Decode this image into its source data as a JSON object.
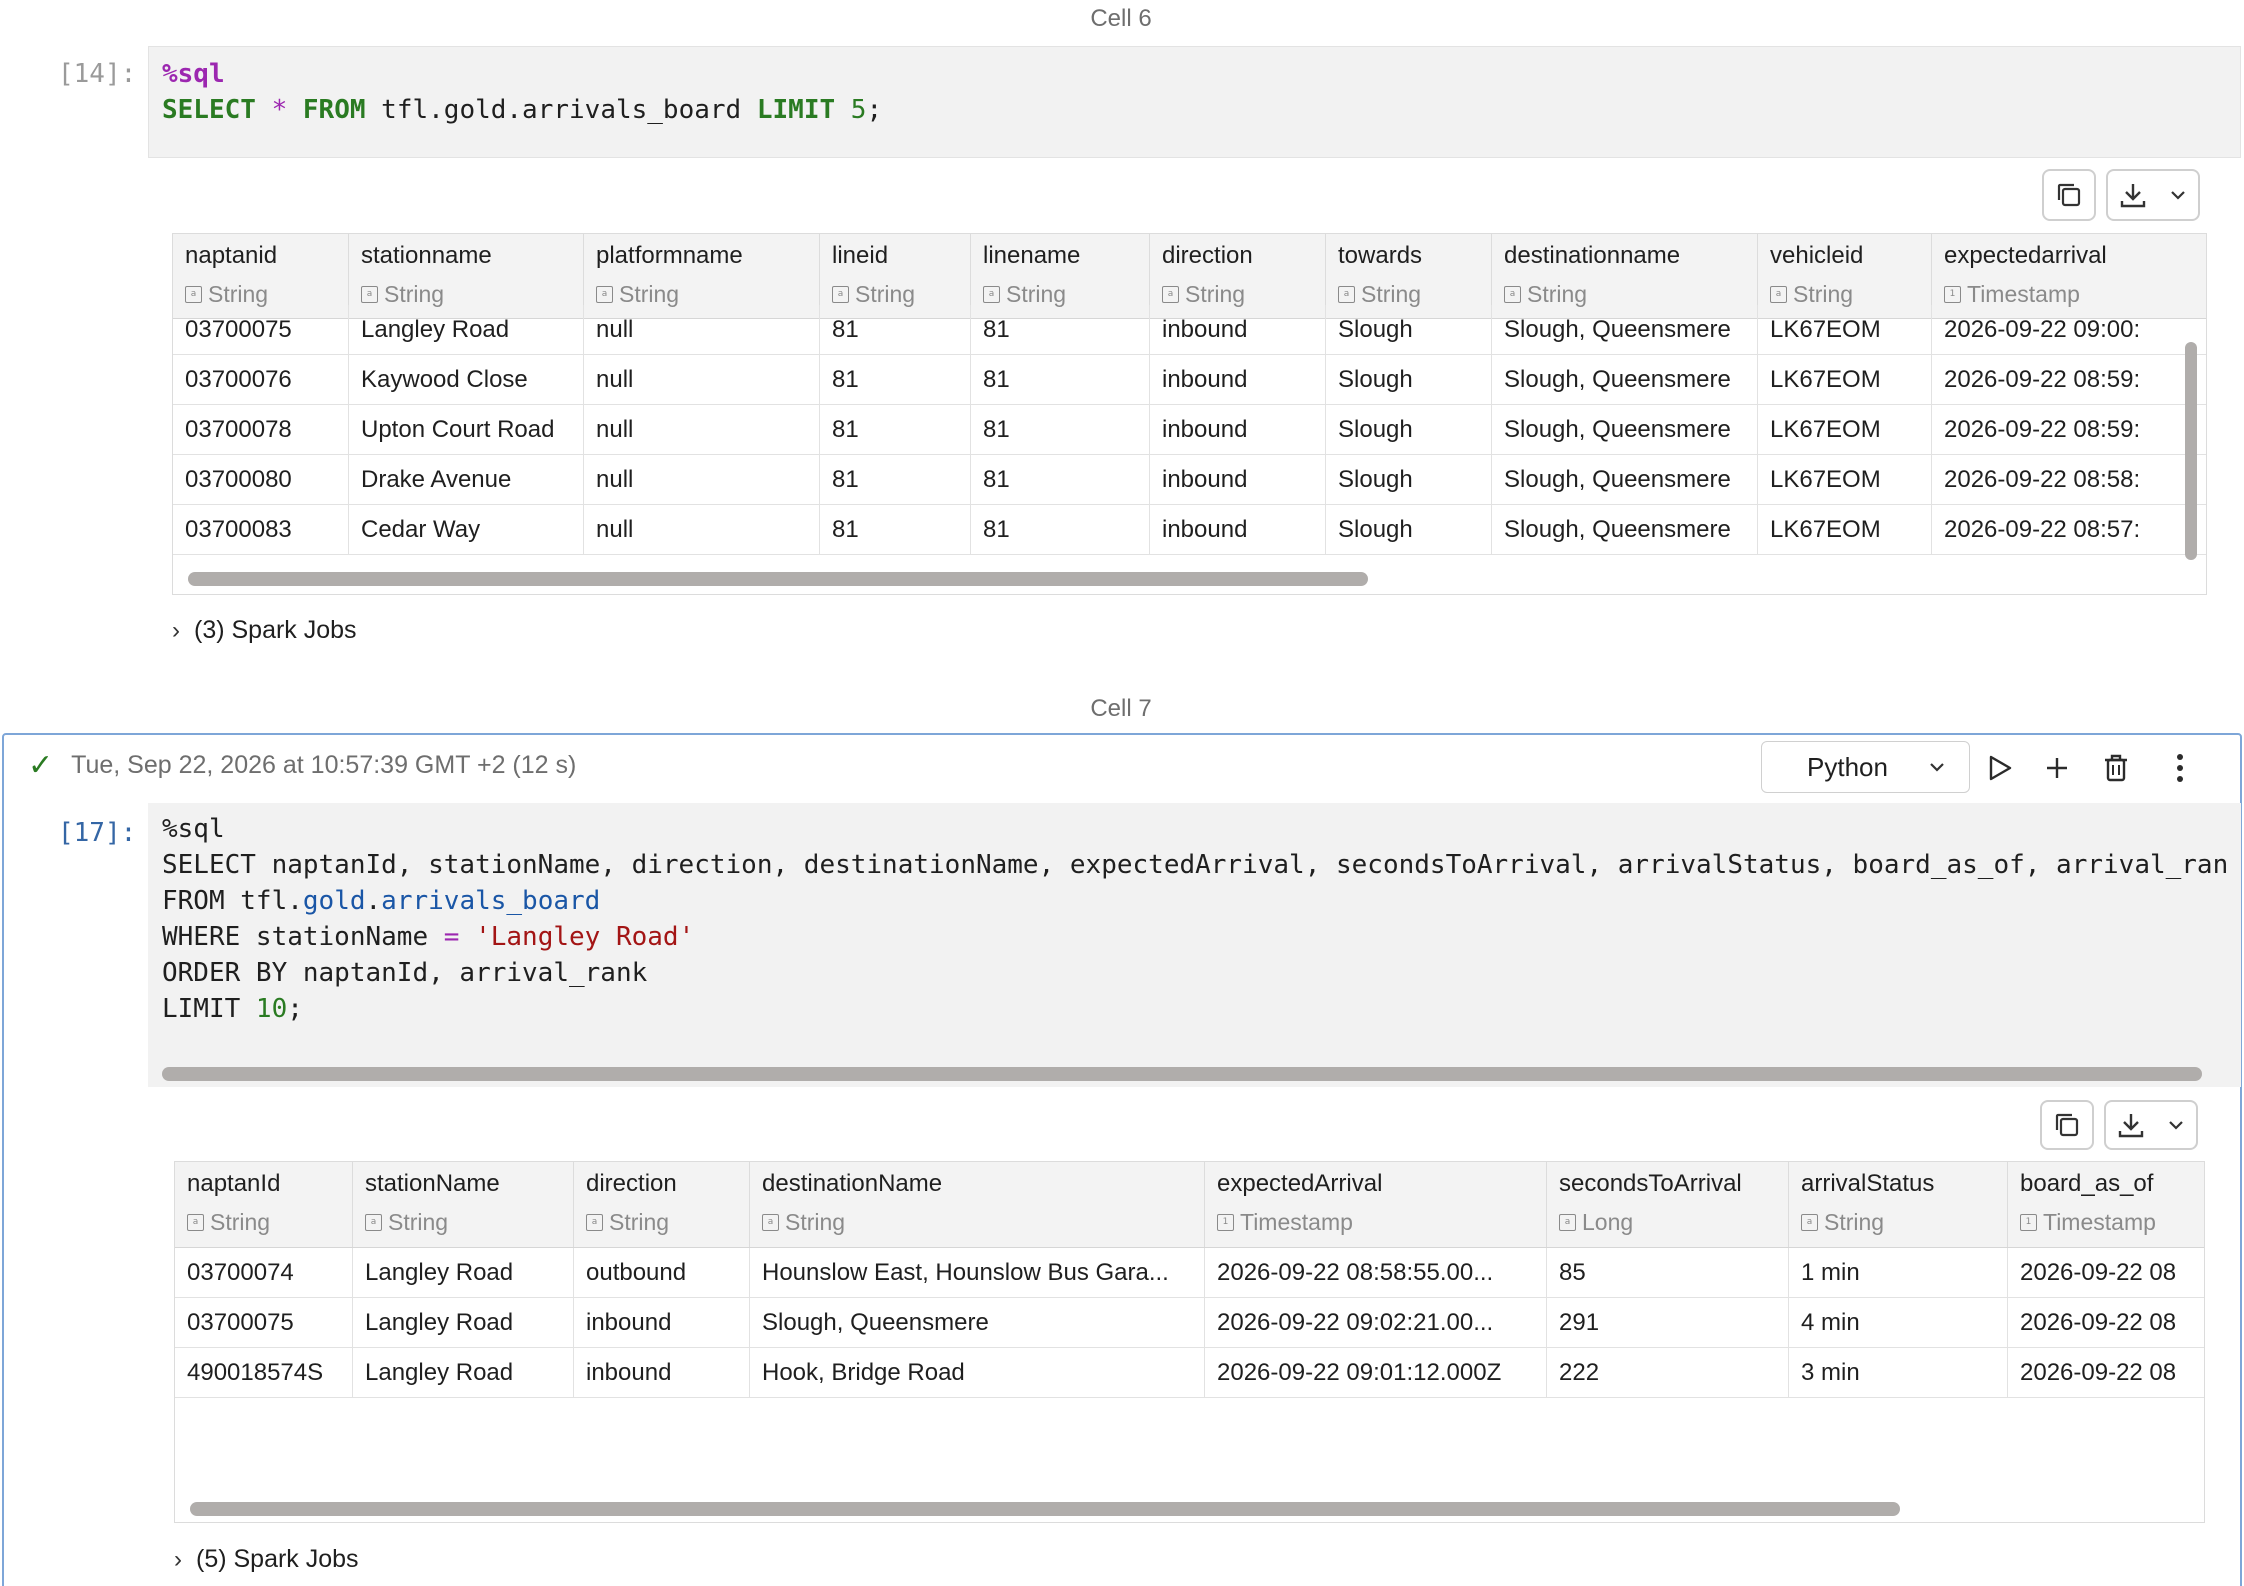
{
  "cell6": {
    "label": "Cell 6",
    "prompt": "[14]:",
    "code_line1_magic": "%sql",
    "code_line2": {
      "select": "SELECT",
      "star": "*",
      "from": "FROM",
      "table": "tfl.gold.arrivals_board",
      "limit": "LIMIT",
      "n": "5",
      "semi": ";"
    },
    "table": {
      "columns": [
        {
          "name": "naptanid",
          "type": "String",
          "type_icon": "abc-icon"
        },
        {
          "name": "stationname",
          "type": "String",
          "type_icon": "abc-icon"
        },
        {
          "name": "platformname",
          "type": "String",
          "type_icon": "abc-icon"
        },
        {
          "name": "lineid",
          "type": "String",
          "type_icon": "abc-icon"
        },
        {
          "name": "linename",
          "type": "String",
          "type_icon": "abc-icon"
        },
        {
          "name": "direction",
          "type": "String",
          "type_icon": "abc-icon"
        },
        {
          "name": "towards",
          "type": "String",
          "type_icon": "abc-icon"
        },
        {
          "name": "destinationname",
          "type": "String",
          "type_icon": "abc-icon"
        },
        {
          "name": "vehicleid",
          "type": "String",
          "type_icon": "abc-icon"
        },
        {
          "name": "expectedarrival",
          "type": "Timestamp",
          "type_icon": "calendar-icon"
        }
      ],
      "rows": [
        [
          "03700075",
          "Langley Road",
          "null",
          "81",
          "81",
          "inbound",
          "Slough",
          "Slough, Queensmere",
          "LK67EOM",
          "2026-09-22 09:00:"
        ],
        [
          "03700076",
          "Kaywood Close",
          "null",
          "81",
          "81",
          "inbound",
          "Slough",
          "Slough, Queensmere",
          "LK67EOM",
          "2026-09-22 08:59:"
        ],
        [
          "03700078",
          "Upton Court Road",
          "null",
          "81",
          "81",
          "inbound",
          "Slough",
          "Slough, Queensmere",
          "LK67EOM",
          "2026-09-22 08:59:"
        ],
        [
          "03700080",
          "Drake Avenue",
          "null",
          "81",
          "81",
          "inbound",
          "Slough",
          "Slough, Queensmere",
          "LK67EOM",
          "2026-09-22 08:58:"
        ],
        [
          "03700083",
          "Cedar Way",
          "null",
          "81",
          "81",
          "inbound",
          "Slough",
          "Slough, Queensmere",
          "LK67EOM",
          "2026-09-22 08:57:"
        ]
      ]
    },
    "spark_jobs": "(3) Spark Jobs"
  },
  "cell7": {
    "label": "Cell 7",
    "status": "Tue, Sep 22, 2026 at 10:57:39 GMT +2 (12 s)",
    "language": "Python",
    "prompt": "[17]:",
    "code": {
      "l1": "%sql",
      "l2": "SELECT naptanId, stationName, direction, destinationName, expectedArrival, secondsToArrival, arrivalStatus, board_as_of, arrival_ran",
      "l3_a": "FROM tfl.",
      "l3_b": "gold",
      "l3_c": ".",
      "l3_d": "arrivals_board",
      "l4_a": "WHERE stationName ",
      "l4_b": "=",
      "l4_c": " ",
      "l4_d": "'Langley Road'",
      "l5": "ORDER BY naptanId, arrival_rank",
      "l6_a": "LIMIT ",
      "l6_b": "10",
      "l6_c": ";"
    },
    "table": {
      "columns": [
        {
          "name": "naptanId",
          "type": "String",
          "type_icon": "abc-icon"
        },
        {
          "name": "stationName",
          "type": "String",
          "type_icon": "abc-icon"
        },
        {
          "name": "direction",
          "type": "String",
          "type_icon": "abc-icon"
        },
        {
          "name": "destinationName",
          "type": "String",
          "type_icon": "abc-icon"
        },
        {
          "name": "expectedArrival",
          "type": "Timestamp",
          "type_icon": "calendar-icon"
        },
        {
          "name": "secondsToArrival",
          "type": "Long",
          "type_icon": "abc-icon"
        },
        {
          "name": "arrivalStatus",
          "type": "String",
          "type_icon": "abc-icon"
        },
        {
          "name": "board_as_of",
          "type": "Timestamp",
          "type_icon": "calendar-icon"
        }
      ],
      "rows": [
        [
          "03700074",
          "Langley Road",
          "outbound",
          "Hounslow East, Hounslow Bus Gara...",
          "2026-09-22 08:58:55.00...",
          "85",
          "1 min",
          "2026-09-22 08"
        ],
        [
          "03700075",
          "Langley Road",
          "inbound",
          "Slough, Queensmere",
          "2026-09-22 09:02:21.00...",
          "291",
          "4 min",
          "2026-09-22 08"
        ],
        [
          "490018574S",
          "Langley Road",
          "inbound",
          "Hook, Bridge Road",
          "2026-09-22 09:01:12.000Z",
          "222",
          "3 min",
          "2026-09-22 08"
        ]
      ]
    },
    "spark_jobs": "(5) Spark Jobs"
  }
}
